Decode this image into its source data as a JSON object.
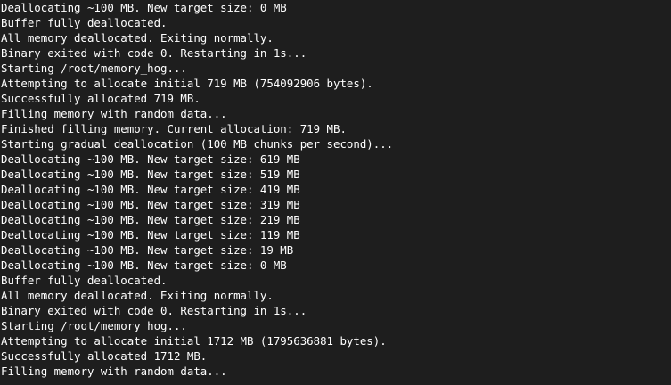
{
  "terminal": {
    "lines": [
      "Deallocating ~100 MB. New target size: 0 MB",
      "Buffer fully deallocated.",
      "All memory deallocated. Exiting normally.",
      "Binary exited with code 0. Restarting in 1s...",
      "Starting /root/memory_hog...",
      "Attempting to allocate initial 719 MB (754092906 bytes).",
      "Successfully allocated 719 MB.",
      "Filling memory with random data...",
      "Finished filling memory. Current allocation: 719 MB.",
      "Starting gradual deallocation (100 MB chunks per second)...",
      "Deallocating ~100 MB. New target size: 619 MB",
      "Deallocating ~100 MB. New target size: 519 MB",
      "Deallocating ~100 MB. New target size: 419 MB",
      "Deallocating ~100 MB. New target size: 319 MB",
      "Deallocating ~100 MB. New target size: 219 MB",
      "Deallocating ~100 MB. New target size: 119 MB",
      "Deallocating ~100 MB. New target size: 19 MB",
      "Deallocating ~100 MB. New target size: 0 MB",
      "Buffer fully deallocated.",
      "All memory deallocated. Exiting normally.",
      "Binary exited with code 0. Restarting in 1s...",
      "Starting /root/memory_hog...",
      "Attempting to allocate initial 1712 MB (1795636881 bytes).",
      "Successfully allocated 1712 MB.",
      "Filling memory with random data..."
    ]
  }
}
